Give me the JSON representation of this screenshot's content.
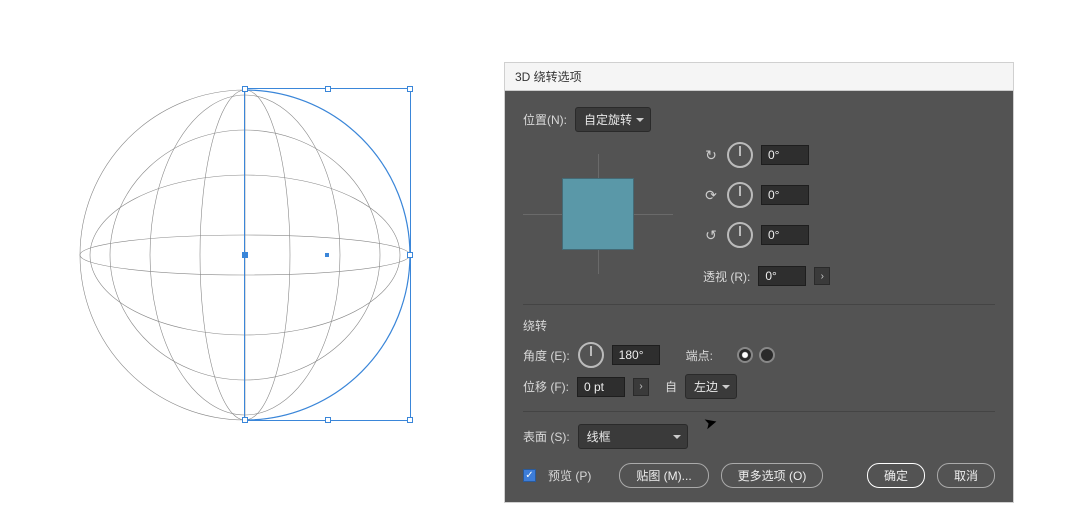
{
  "dialog": {
    "title": "3D 绕转选项",
    "position": {
      "label": "位置(N):",
      "value": "自定旋转"
    },
    "rotations": [
      {
        "axis_icon": "↻",
        "value": "0°"
      },
      {
        "axis_icon": "⟳",
        "value": "0°"
      },
      {
        "axis_icon": "↺",
        "value": "0°"
      }
    ],
    "perspective": {
      "label": "透视 (R):",
      "value": "0°"
    },
    "revolve": {
      "section_title": "绕转",
      "angle": {
        "label": "角度 (E):",
        "value": "180°"
      },
      "endpoint_label": "端点:",
      "offset": {
        "label": "位移 (F):",
        "value": "0 pt",
        "from_label": "自",
        "from_value": "左边"
      }
    },
    "surface": {
      "label": "表面 (S):",
      "value": "线框"
    },
    "footer": {
      "preview_label": "预览 (P)",
      "map_art": "贴图 (M)...",
      "more_options": "更多选项 (O)",
      "ok": "确定",
      "cancel": "取消"
    }
  },
  "colors": {
    "cube_face": "#5a98a8",
    "selection": "#3a86d9"
  }
}
